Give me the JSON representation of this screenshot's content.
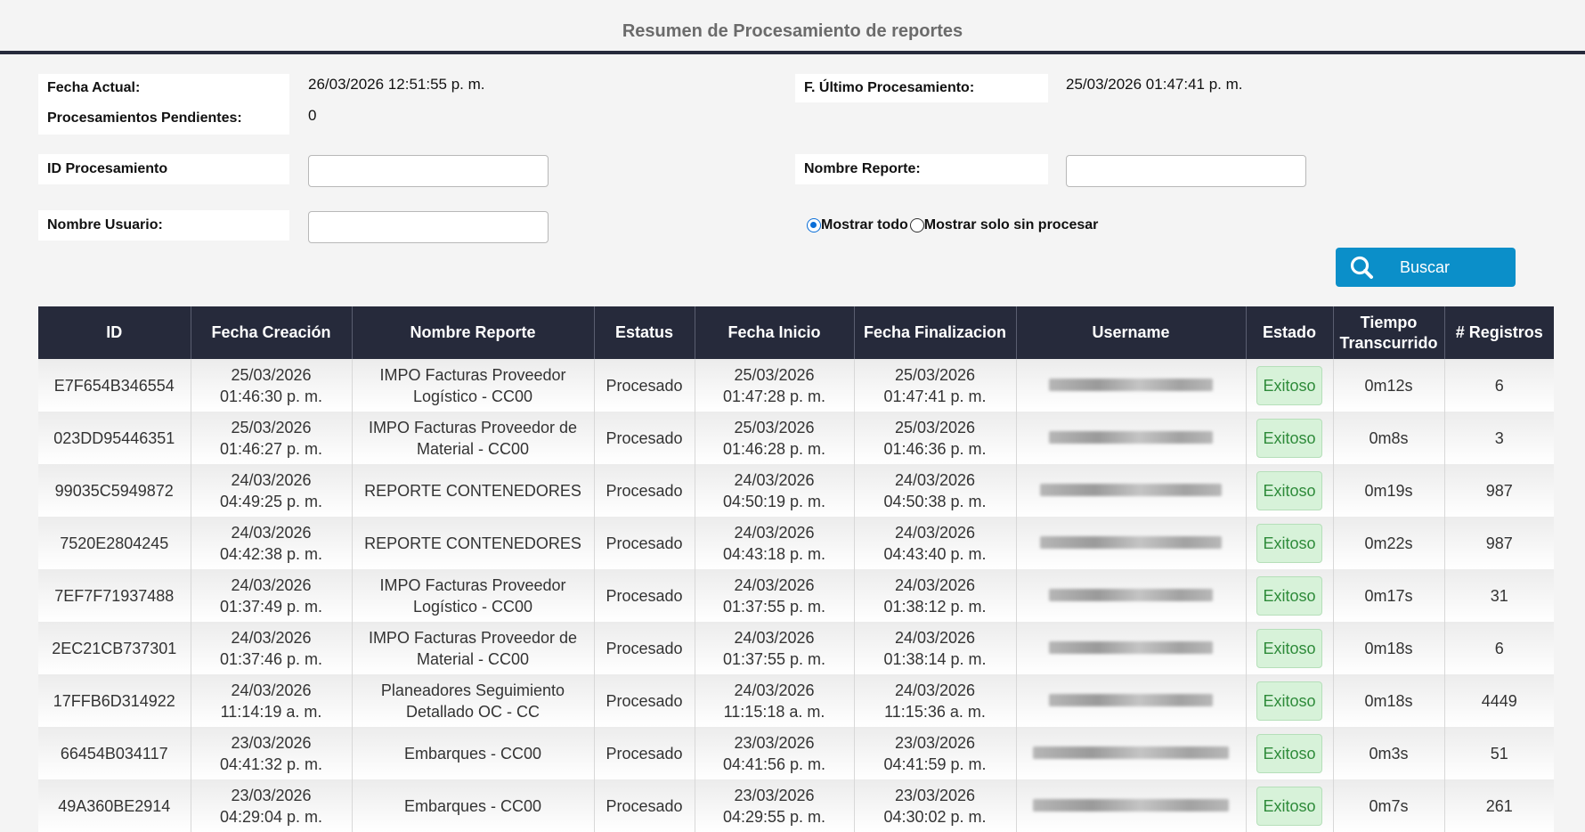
{
  "page": {
    "title": "Resumen de Procesamiento de reportes"
  },
  "info": {
    "fecha_actual_label": "Fecha Actual:",
    "fecha_actual_value": "26/03/2026 12:51:55 p. m.",
    "pendientes_label": "Procesamientos Pendientes:",
    "pendientes_value": "0",
    "ultimo_label": "F. Último Procesamiento:",
    "ultimo_value": "25/03/2026 01:47:41 p. m."
  },
  "filters": {
    "id_label": "ID Procesamiento",
    "id_value": "",
    "nombre_reporte_label": "Nombre Reporte:",
    "nombre_reporte_value": "",
    "nombre_usuario_label": "Nombre Usuario:",
    "nombre_usuario_value": "",
    "radio_all_label": "Mostrar todo",
    "radio_pending_label": "Mostrar solo sin procesar",
    "selected": "all",
    "search_label": "Buscar"
  },
  "colors": {
    "header_bg": "#262a3b",
    "button_bg": "#0b8fc9",
    "badge_bg": "#d7f2d9",
    "badge_text": "#2e8b3a"
  },
  "table": {
    "columns": [
      "ID",
      "Fecha Creación",
      "Nombre Reporte",
      "Estatus",
      "Fecha Inicio",
      "Fecha Finalizacion",
      "Username",
      "Estado",
      "Tiempo Transcurrido",
      "# Registros"
    ],
    "rows": [
      {
        "id": "E7F654B346554",
        "creacion": [
          "25/03/2026",
          "01:46:30 p. m."
        ],
        "reporte": [
          "IMPO Facturas Proveedor",
          "Logístico - CC00"
        ],
        "estatus": "Procesado",
        "inicio": [
          "25/03/2026",
          "01:47:28 p. m."
        ],
        "fin": [
          "25/03/2026",
          "01:47:41 p. m."
        ],
        "estado": "Exitoso",
        "tiempo": "0m12s",
        "registros": "6"
      },
      {
        "id": "023DD95446351",
        "creacion": [
          "25/03/2026",
          "01:46:27 p. m."
        ],
        "reporte": [
          "IMPO Facturas Proveedor de",
          "Material - CC00"
        ],
        "estatus": "Procesado",
        "inicio": [
          "25/03/2026",
          "01:46:28 p. m."
        ],
        "fin": [
          "25/03/2026",
          "01:46:36 p. m."
        ],
        "estado": "Exitoso",
        "tiempo": "0m8s",
        "registros": "3"
      },
      {
        "id": "99035C5949872",
        "creacion": [
          "24/03/2026",
          "04:49:25 p. m."
        ],
        "reporte": [
          "REPORTE CONTENEDORES"
        ],
        "estatus": "Procesado",
        "inicio": [
          "24/03/2026",
          "04:50:19 p. m."
        ],
        "fin": [
          "24/03/2026",
          "04:50:38 p. m."
        ],
        "estado": "Exitoso",
        "tiempo": "0m19s",
        "registros": "987"
      },
      {
        "id": "7520E2804245",
        "creacion": [
          "24/03/2026",
          "04:42:38 p. m."
        ],
        "reporte": [
          "REPORTE CONTENEDORES"
        ],
        "estatus": "Procesado",
        "inicio": [
          "24/03/2026",
          "04:43:18 p. m."
        ],
        "fin": [
          "24/03/2026",
          "04:43:40 p. m."
        ],
        "estado": "Exitoso",
        "tiempo": "0m22s",
        "registros": "987"
      },
      {
        "id": "7EF7F71937488",
        "creacion": [
          "24/03/2026",
          "01:37:49 p. m."
        ],
        "reporte": [
          "IMPO Facturas Proveedor",
          "Logístico - CC00"
        ],
        "estatus": "Procesado",
        "inicio": [
          "24/03/2026",
          "01:37:55 p. m."
        ],
        "fin": [
          "24/03/2026",
          "01:38:12 p. m."
        ],
        "estado": "Exitoso",
        "tiempo": "0m17s",
        "registros": "31"
      },
      {
        "id": "2EC21CB737301",
        "creacion": [
          "24/03/2026",
          "01:37:46 p. m."
        ],
        "reporte": [
          "IMPO Facturas Proveedor de",
          "Material - CC00"
        ],
        "estatus": "Procesado",
        "inicio": [
          "24/03/2026",
          "01:37:55 p. m."
        ],
        "fin": [
          "24/03/2026",
          "01:38:14 p. m."
        ],
        "estado": "Exitoso",
        "tiempo": "0m18s",
        "registros": "6"
      },
      {
        "id": "17FFB6D314922",
        "creacion": [
          "24/03/2026",
          "11:14:19 a. m."
        ],
        "reporte": [
          "Planeadores Seguimiento",
          "Detallado OC - CC"
        ],
        "estatus": "Procesado",
        "inicio": [
          "24/03/2026",
          "11:15:18 a. m."
        ],
        "fin": [
          "24/03/2026",
          "11:15:36 a. m."
        ],
        "estado": "Exitoso",
        "tiempo": "0m18s",
        "registros": "4449"
      },
      {
        "id": "66454B034117",
        "creacion": [
          "23/03/2026",
          "04:41:32 p. m."
        ],
        "reporte": [
          "Embarques - CC00"
        ],
        "estatus": "Procesado",
        "inicio": [
          "23/03/2026",
          "04:41:56 p. m."
        ],
        "fin": [
          "23/03/2026",
          "04:41:59 p. m."
        ],
        "estado": "Exitoso",
        "tiempo": "0m3s",
        "registros": "51"
      },
      {
        "id": "49A360BE2914",
        "creacion": [
          "23/03/2026",
          "04:29:04 p. m."
        ],
        "reporte": [
          "Embarques - CC00"
        ],
        "estatus": "Procesado",
        "inicio": [
          "23/03/2026",
          "04:29:55 p. m."
        ],
        "fin": [
          "23/03/2026",
          "04:30:02 p. m."
        ],
        "estado": "Exitoso",
        "tiempo": "0m7s",
        "registros": "261"
      }
    ]
  }
}
